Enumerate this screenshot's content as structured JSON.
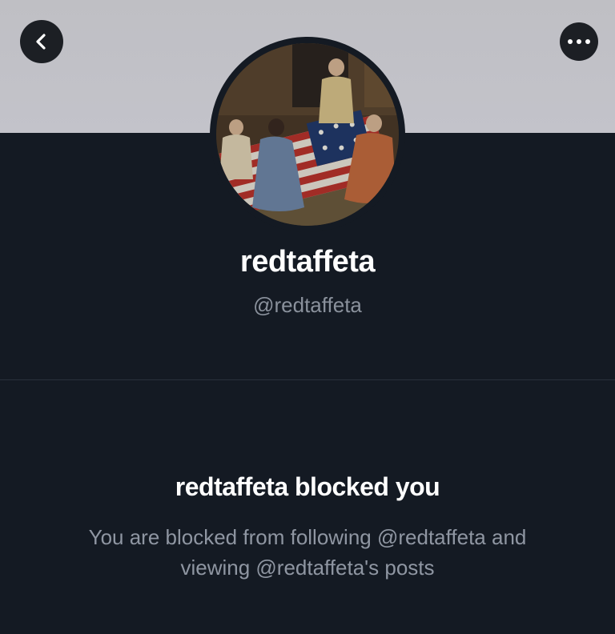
{
  "profile": {
    "display_name": "redtaffeta",
    "handle": "@redtaffeta"
  },
  "blocked_notice": {
    "title": "redtaffeta blocked you",
    "description": "You are blocked from following @redtaffeta and viewing @redtaffeta's posts"
  },
  "icons": {
    "back": "chevron-left-icon",
    "more": "ellipsis-horizontal-icon"
  },
  "colors": {
    "background": "#141a23",
    "banner": "#c1c1c7",
    "button_bg": "#1c1f24",
    "primary_text": "#ffffff",
    "secondary_text": "#8a919c"
  }
}
